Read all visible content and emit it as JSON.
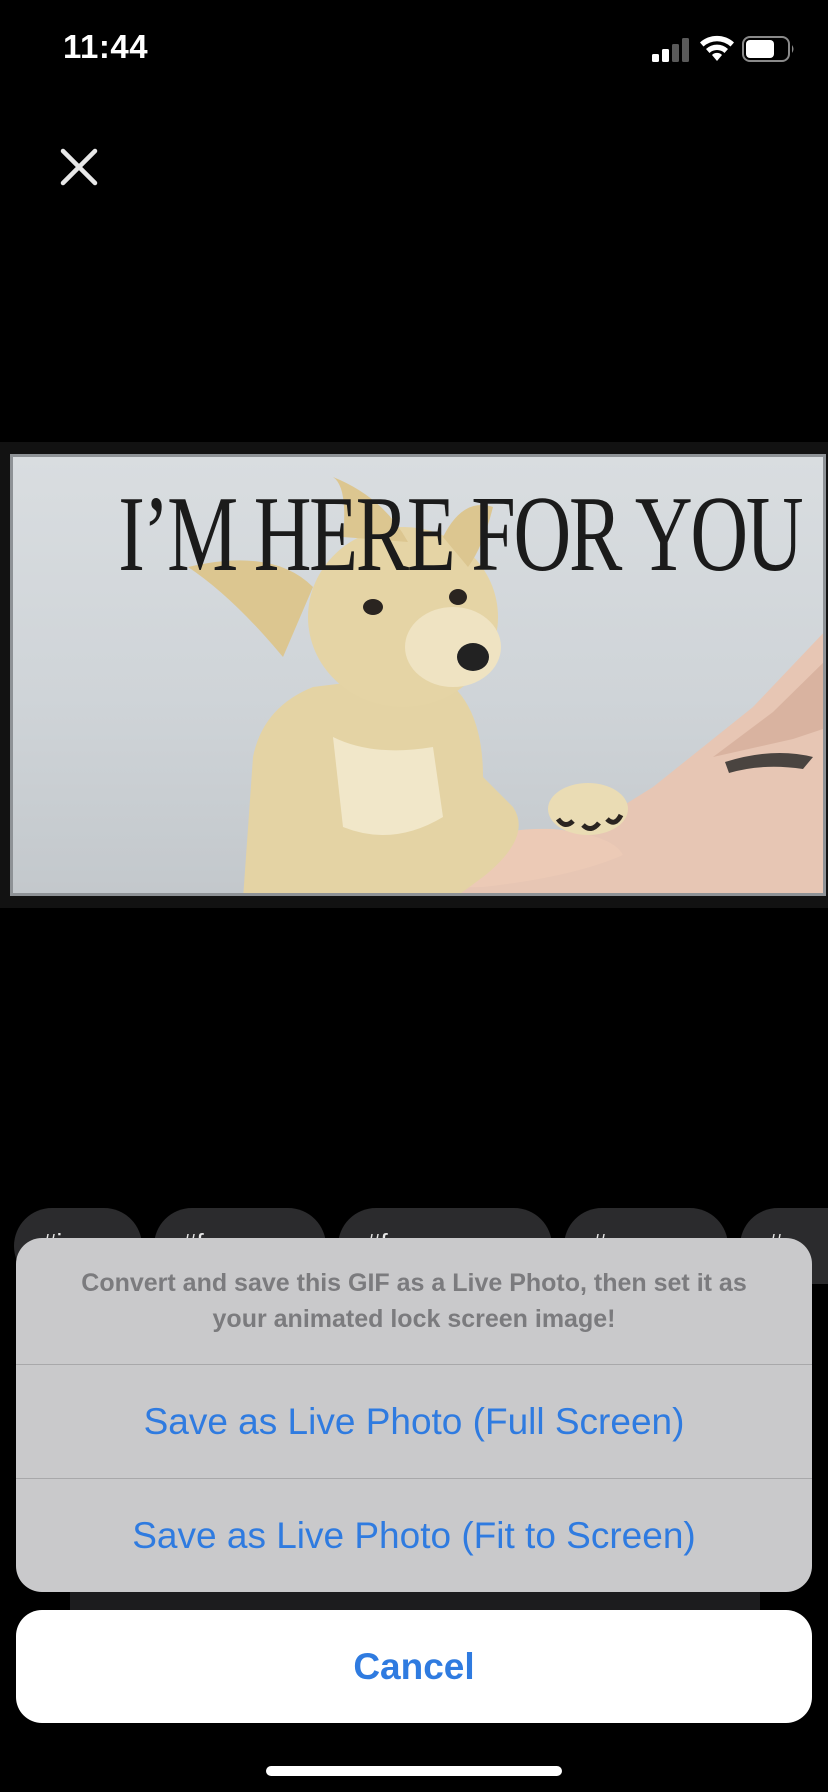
{
  "status_bar": {
    "time": "11:44",
    "icons": [
      "signal-icon",
      "wifi-icon",
      "battery-icon"
    ]
  },
  "close_icon": "close-icon",
  "gif": {
    "caption": "I’M HERE FOR YOU"
  },
  "tags": [
    "#i...",
    "#f...",
    "#f...",
    "#...",
    "#..."
  ],
  "action_sheet": {
    "message": "Convert and save this GIF as a Live Photo, then set it as your animated lock screen image!",
    "actions": [
      "Save as Live Photo (Full Screen)",
      "Save as Live Photo (Fit to Screen)"
    ],
    "cancel": "Cancel"
  },
  "colors": {
    "background": "#000000",
    "sheet": "#c9c9cb",
    "accent": "#2f7be0",
    "message": "#7b7b7e"
  }
}
